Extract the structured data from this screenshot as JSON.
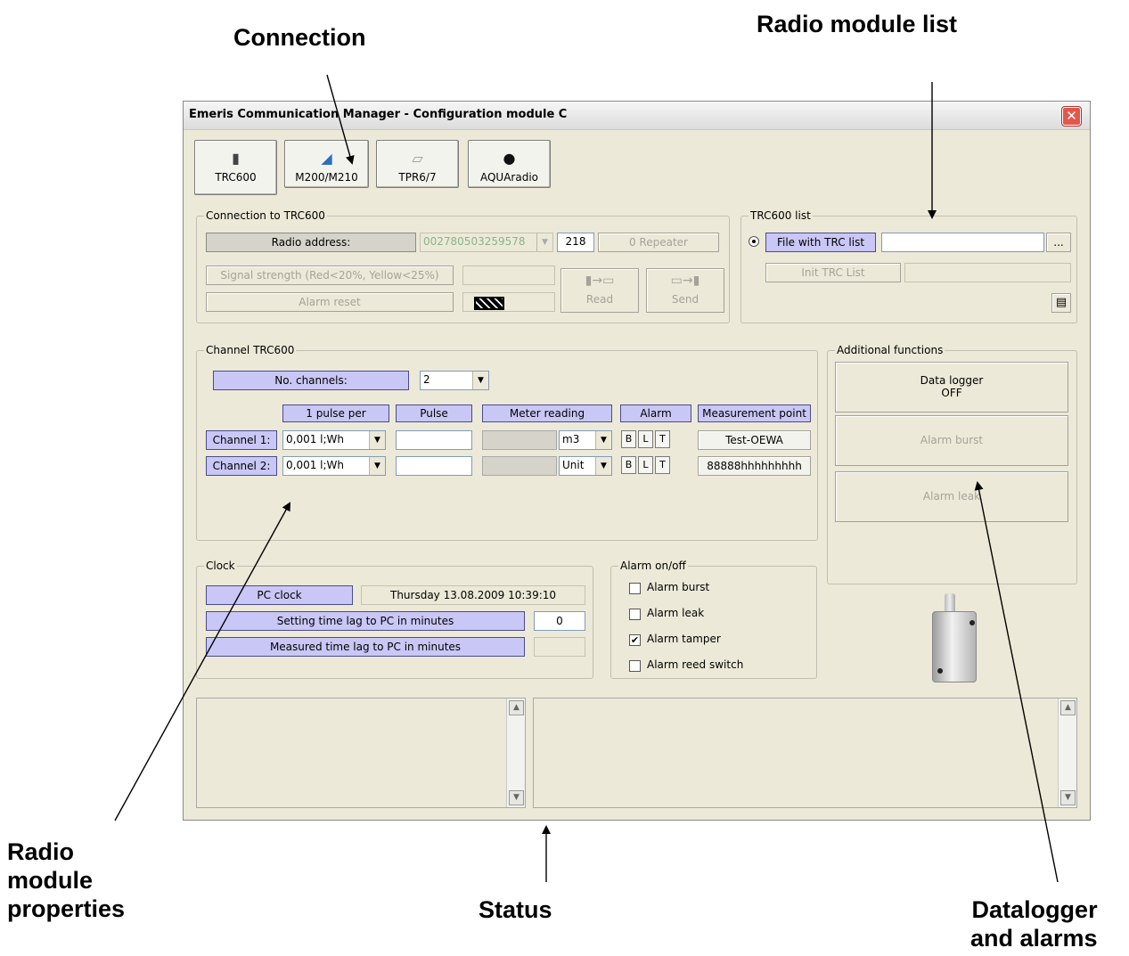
{
  "callouts": {
    "connection": "Connection",
    "radio_module_list": "Radio module list",
    "radio_module_properties_1": "Radio",
    "radio_module_properties_2": "module",
    "radio_module_properties_3": "properties",
    "status": "Status",
    "datalogger_1": "Datalogger",
    "datalogger_2": "and alarms"
  },
  "window": {
    "title": "Emeris Communication Manager - Configuration module C",
    "close": "✕"
  },
  "toolbar": {
    "trc600": "TRC600",
    "m200": "M200/M210",
    "tpr": "TPR6/7",
    "aqua": "AQUAradio"
  },
  "connection": {
    "group": "Connection to TRC600",
    "radio_address_label": "Radio address:",
    "radio_address_value": "002780503259578",
    "number": "218",
    "repeater": "0 Repeater",
    "signal_strength": "Signal strength (Red<20%, Yellow<25%)",
    "alarm_reset": "Alarm reset",
    "read": "Read",
    "send": "Send"
  },
  "trc_list": {
    "group": "TRC600 list",
    "file_btn": "File with TRC list",
    "browse": "...",
    "init": "Init TRC List"
  },
  "channel": {
    "group": "Channel TRC600",
    "no_channels_label": "No. channels:",
    "no_channels_value": "2",
    "headers": {
      "pulse_per": "1 pulse per",
      "pulse": "Pulse",
      "meter_reading": "Meter reading",
      "alarm": "Alarm",
      "measurement_point": "Measurement point"
    },
    "rows": [
      {
        "label": "Channel 1:",
        "pulse_per": "0,001  l;Wh",
        "unit": "m3",
        "b": "B",
        "l": "L",
        "t": "T",
        "point": "Test-OEWA"
      },
      {
        "label": "Channel 2:",
        "pulse_per": "0,001  l;Wh",
        "unit": "Unit",
        "b": "B",
        "l": "L",
        "t": "T",
        "point": "88888hhhhhhhhh"
      }
    ]
  },
  "additional": {
    "group": "Additional functions",
    "datalogger_1": "Data logger",
    "datalogger_2": "OFF",
    "alarm_burst": "Alarm burst",
    "alarm_leak": "Alarm leak"
  },
  "clock": {
    "group": "Clock",
    "pc_clock": "PC clock",
    "pc_clock_value": "Thursday   13.08.2009 10:39:10",
    "setting_lag": "Setting time lag to PC in minutes",
    "setting_lag_value": "0",
    "measured_lag": "Measured time lag to PC in minutes"
  },
  "alarm_onoff": {
    "group": "Alarm  on/off",
    "items": [
      {
        "label": "Alarm burst",
        "checked": false
      },
      {
        "label": "Alarm leak",
        "checked": false
      },
      {
        "label": "Alarm tamper",
        "checked": true
      },
      {
        "label": "Alarm reed switch",
        "checked": false
      }
    ],
    "check_mark": "✔"
  }
}
